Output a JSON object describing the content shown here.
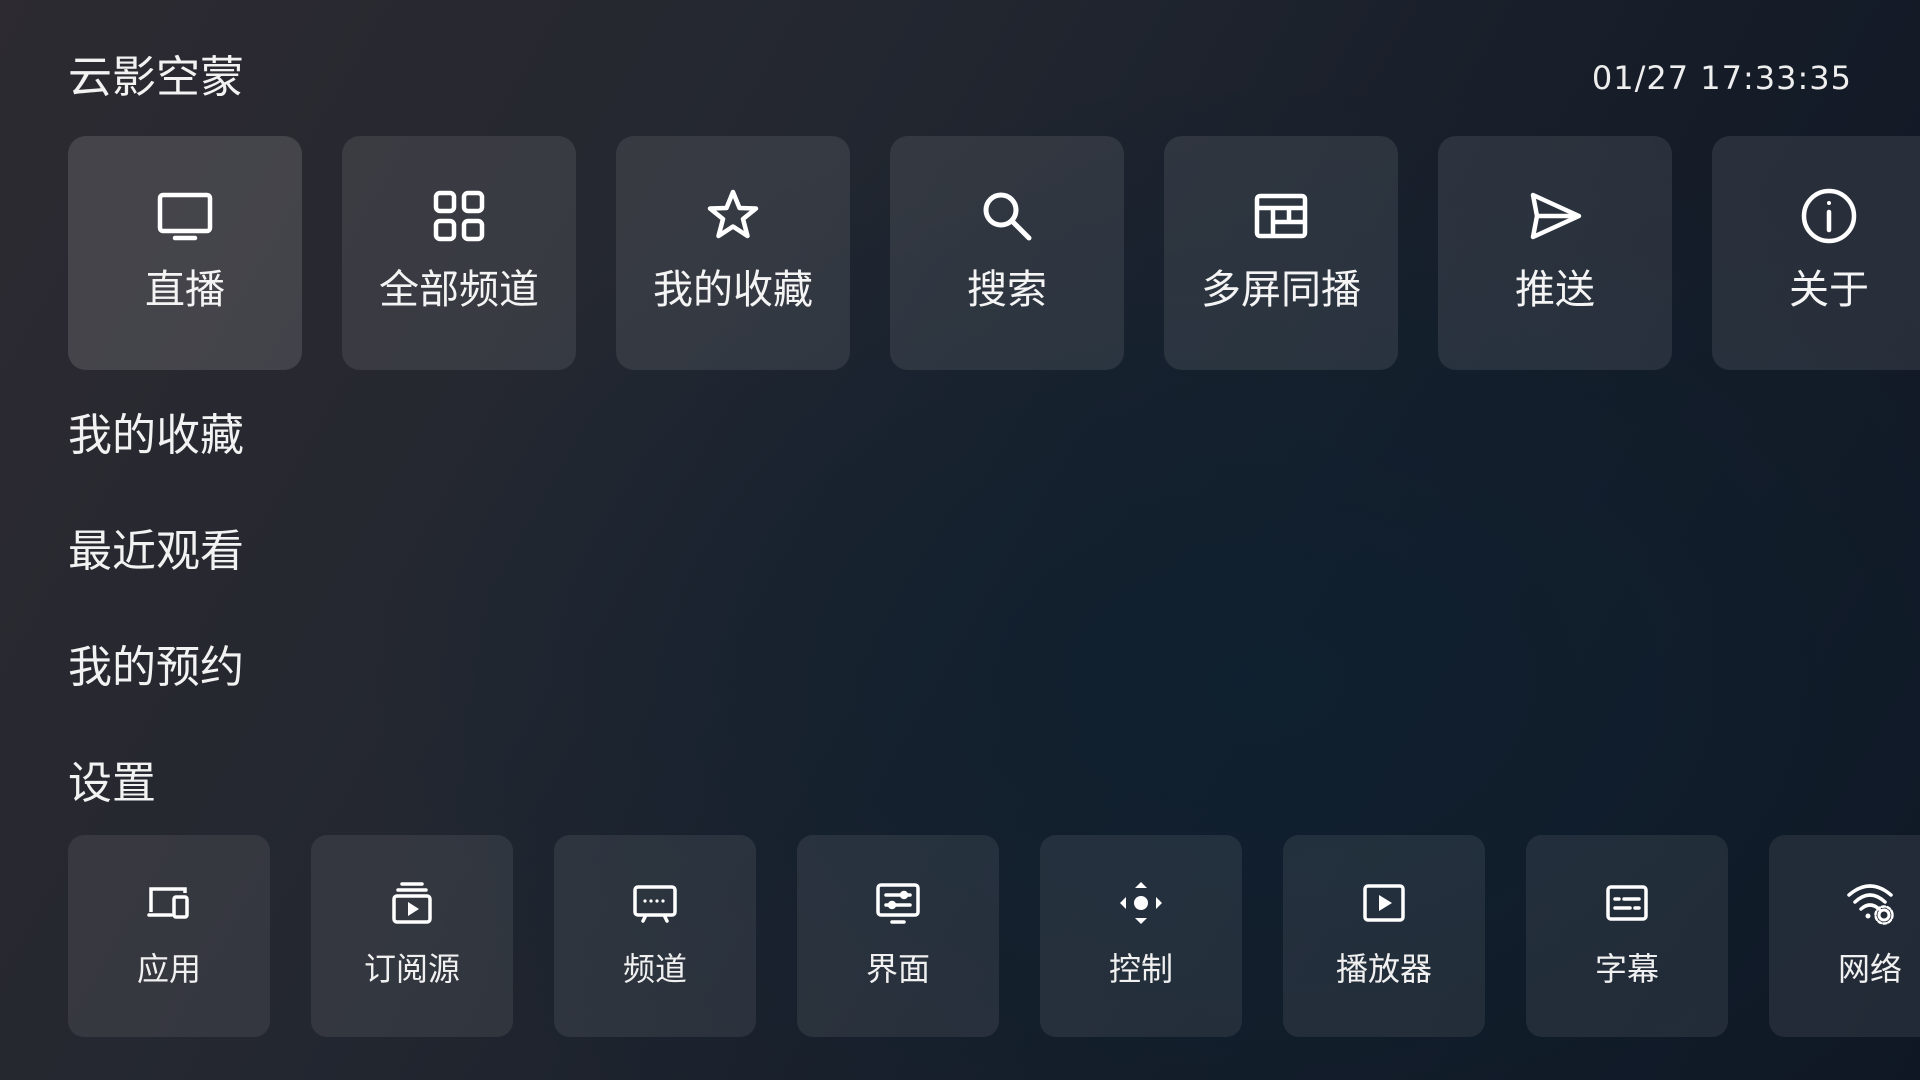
{
  "header": {
    "app_title": "云影空蒙",
    "datetime": "01/27 17:33:35"
  },
  "top_menu": [
    {
      "label": "直播",
      "icon": "tv-icon"
    },
    {
      "label": "全部频道",
      "icon": "grid-icon"
    },
    {
      "label": "我的收藏",
      "icon": "star-icon"
    },
    {
      "label": "搜索",
      "icon": "search-icon"
    },
    {
      "label": "多屏同播",
      "icon": "multi-screen-icon"
    },
    {
      "label": "推送",
      "icon": "send-icon"
    },
    {
      "label": "关于",
      "icon": "info-icon"
    }
  ],
  "sections": {
    "favorites": "我的收藏",
    "recent": "最近观看",
    "reservations": "我的预约",
    "settings": "设置"
  },
  "settings_menu": [
    {
      "label": "应用",
      "icon": "devices-icon"
    },
    {
      "label": "订阅源",
      "icon": "subscriptions-icon"
    },
    {
      "label": "频道",
      "icon": "channel-icon"
    },
    {
      "label": "界面",
      "icon": "interface-icon"
    },
    {
      "label": "控制",
      "icon": "remote-control-icon"
    },
    {
      "label": "播放器",
      "icon": "player-icon"
    },
    {
      "label": "字幕",
      "icon": "subtitles-icon"
    },
    {
      "label": "网络",
      "icon": "wifi-settings-icon"
    }
  ]
}
